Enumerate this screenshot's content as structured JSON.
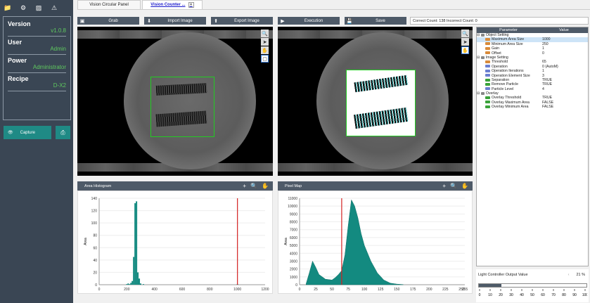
{
  "sidebar": {
    "icons": [
      "folder-icon",
      "bug-icon",
      "pin-icon",
      "warning-icon"
    ],
    "info": [
      {
        "label": "Version",
        "value": "v1.0.8"
      },
      {
        "label": "User",
        "value": "Admin"
      },
      {
        "label": "Power",
        "value": "Administrator"
      },
      {
        "label": "Recipe",
        "value": "D-X2"
      }
    ],
    "capture_label": "Capture"
  },
  "tabs": [
    {
      "label": "Vision Circular Panel"
    },
    {
      "label": "Vision Counter ..."
    }
  ],
  "toolbar": {
    "grab": "Grab",
    "import": "Import Image",
    "export": "Export Image",
    "execution": "Execution",
    "save": "Save"
  },
  "counts": "Correct Count: 138  Incorrect Count: 0",
  "histogram": {
    "title": "Area Histogram"
  },
  "pixelmap": {
    "title": "Pixel Map"
  },
  "properties": {
    "col_param": "Parameter",
    "col_value": "Value",
    "groups": [
      {
        "name": "Object Setting",
        "items": [
          {
            "name": "Maximum Area Size",
            "value": "1000",
            "color": "#d98b3a",
            "selected": true
          },
          {
            "name": "Minimum Area Size",
            "value": "250",
            "color": "#d98b3a"
          },
          {
            "name": "Gain",
            "value": "1",
            "color": "#d98b3a"
          },
          {
            "name": "Offset",
            "value": "0",
            "color": "#d98b3a"
          }
        ]
      },
      {
        "name": "Image Setting",
        "items": [
          {
            "name": "Threshold",
            "value": "65",
            "color": "#d98b3a"
          },
          {
            "name": "Operation",
            "value": "0 (AutoM)",
            "color": "#6a7fd0"
          },
          {
            "name": "Operation Iterations",
            "value": "1",
            "color": "#6a7fd0"
          },
          {
            "name": "Operation Element Size",
            "value": "3",
            "color": "#6a7fd0"
          },
          {
            "name": "Separation",
            "value": "TRUE",
            "color": "#3aa23a"
          },
          {
            "name": "Remove Particle",
            "value": "TRUE",
            "color": "#3aa23a"
          },
          {
            "name": "Particle Level",
            "value": "4",
            "color": "#6a7fd0"
          }
        ]
      },
      {
        "name": "Overlay",
        "items": [
          {
            "name": "Overlay Threshold",
            "value": "TRUE",
            "color": "#3aa23a"
          },
          {
            "name": "Overlay Maximum Area",
            "value": "FALSE",
            "color": "#3aa23a"
          },
          {
            "name": "Overlay Minimum Area",
            "value": "FALSE",
            "color": "#3aa23a"
          }
        ]
      }
    ]
  },
  "light": {
    "label": "Light Controller Output Value",
    "value": "21 %",
    "level": 21,
    "ticks": [
      "0",
      "10",
      "20",
      "30",
      "40",
      "50",
      "60",
      "70",
      "80",
      "90",
      "100"
    ]
  },
  "chart_data": [
    {
      "type": "bar",
      "title": "Area Histogram",
      "x": [
        200,
        210,
        220,
        230,
        240,
        250,
        260,
        270,
        280,
        290,
        300,
        320,
        1000
      ],
      "values": [
        1,
        2,
        1,
        3,
        6,
        45,
        132,
        135,
        20,
        10,
        2,
        1,
        1
      ],
      "threshold_line": 1000,
      "xlim": [
        0,
        1200
      ],
      "ylim": [
        0,
        140
      ],
      "xticks": [
        "0",
        "200",
        "400",
        "600",
        "800",
        "1000",
        "1200"
      ],
      "yticks": [
        "0",
        "20",
        "40",
        "60",
        "80",
        "100",
        "120",
        "140"
      ],
      "ylabel": "Area"
    },
    {
      "type": "area",
      "title": "Pixel Map",
      "x": [
        10,
        15,
        20,
        25,
        30,
        40,
        50,
        55,
        60,
        65,
        70,
        75,
        80,
        85,
        90,
        95,
        100,
        110,
        120,
        130,
        140,
        150,
        160
      ],
      "values": [
        100,
        1500,
        3000,
        2200,
        1300,
        700,
        600,
        900,
        1300,
        1800,
        3800,
        7500,
        10800,
        10000,
        8500,
        6500,
        5000,
        3000,
        1500,
        600,
        200,
        80,
        20
      ],
      "threshold_line": 65,
      "xlim": [
        0,
        255
      ],
      "ylim": [
        0,
        11000
      ],
      "xticks": [
        "0",
        "25",
        "50",
        "75",
        "100",
        "125",
        "150",
        "175",
        "200",
        "225",
        "250",
        "255"
      ],
      "yticks": [
        "0",
        "1000",
        "2000",
        "3000",
        "4000",
        "5000",
        "6000",
        "7000",
        "8000",
        "9000",
        "10000",
        "11000"
      ],
      "ylabel": "Area"
    }
  ]
}
